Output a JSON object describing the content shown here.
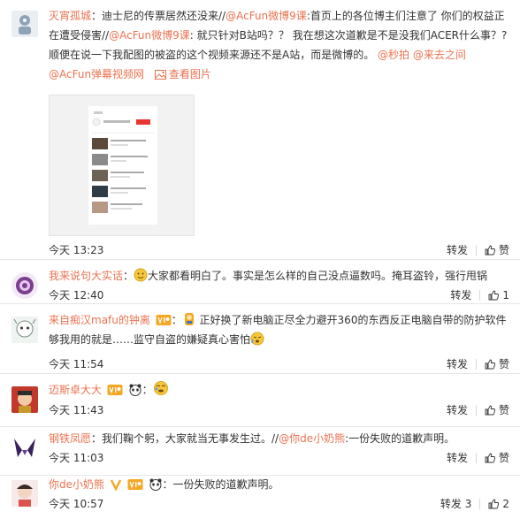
{
  "comments": [
    {
      "user": "灭宵孤城",
      "parts": {
        "t1": "：迪士尼的传票居然还没来//",
        "m1": "@AcFun微博9课",
        "t2": ":首页上的各位博主们注意了 你们的权益正在遭受侵害//",
        "m2": "@AcFun微博9课",
        "t3": ": 就只针对B站吗？？ 我在想这次道歉是不是没我们ACER什么事？?顺便在说一下我配图的被盗的这个视频来源还不是A站，而是微博的。 ",
        "m3": "@秒拍",
        "m4": "@来去之间",
        "m5": "@AcFun弹幕视频网",
        "view_image": "查看图片"
      },
      "time": "今天 13:23",
      "repost": "转发",
      "like": "赞",
      "like_count": ""
    },
    {
      "user": "我来说句大实话",
      "text": "大家都看明白了。事实是怎么样的自己没点逼数吗。掩耳盗铃，强行甩锅",
      "time": "今天 12:40",
      "repost": "转发",
      "like": "",
      "like_count": "1"
    },
    {
      "user": "来自痴汉mafu的钟离",
      "text1": "正好换了新电脑正尽全力避开360的东西反正电脑自带的防护软件够我用的就是……监守自盗的嫌疑真心害怕",
      "time": "今天 11:54",
      "repost": "转发",
      "like": "赞",
      "like_count": ""
    },
    {
      "user": "迈斯卓大大",
      "time": "今天 11:43",
      "repost": "转发",
      "like": "赞",
      "like_count": ""
    },
    {
      "user": "钢铁凤愿",
      "text1": "：我们鞠个躬，大家就当无事发生过。//",
      "mention": "@你de小奶熊",
      "text2": ":一份失败的道歉声明。",
      "time": "今天 11:03",
      "repost": "转发",
      "like": "赞",
      "like_count": ""
    },
    {
      "user": "你de小奶熊",
      "text": "：一份失败的道歉声明。",
      "time": "今天 10:57",
      "repost": "转发 3",
      "like": "",
      "like_count": "2"
    }
  ],
  "colors": {
    "link": "#eb7350",
    "text": "#333333",
    "divider": "#e6e6e6"
  }
}
